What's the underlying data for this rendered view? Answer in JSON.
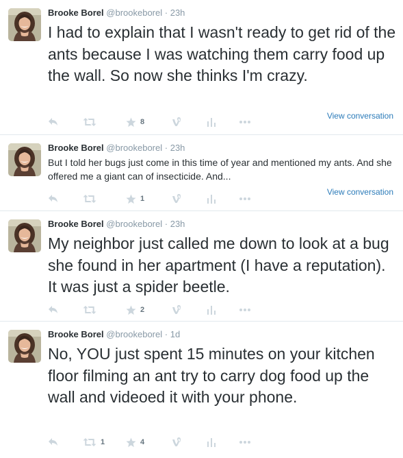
{
  "tweets": [
    {
      "name": "Brooke Borel",
      "handle": "@brookeborel",
      "separator": "·",
      "time": "23h",
      "text": "I had to explain that I wasn't ready to get rid of the ants because I was watching them carry food up the wall. So now she thinks I'm crazy.",
      "view_conversation": "View conversation",
      "retweets": "",
      "favorites": "8"
    },
    {
      "name": "Brooke Borel",
      "handle": "@brookeborel",
      "separator": "·",
      "time": "23h",
      "text": "But I told her bugs just come in this time of year and mentioned my ants. And she offered me a giant can of insecticide. And...",
      "view_conversation": "View conversation",
      "retweets": "",
      "favorites": "1"
    },
    {
      "name": "Brooke Borel",
      "handle": "@brookeborel",
      "separator": "·",
      "time": "23h",
      "text": "My neighbor just called me down to look at a bug she found in her apartment (I have a reputation). It was just a spider beetle.",
      "retweets": "",
      "favorites": "2"
    },
    {
      "name": "Brooke Borel",
      "handle": "@brookeborel",
      "separator": "·",
      "time": "1d",
      "text": "No, YOU just spent 15 minutes on your kitchen floor filming an ant try to carry dog food up the wall and videoed it with your phone.",
      "retweets": "1",
      "favorites": "4"
    }
  ],
  "colors": {
    "icon": "#ccd6dd",
    "count": "#66757f",
    "link": "#2b7bb9",
    "meta": "#8899a6",
    "border": "#e1e8ed"
  }
}
